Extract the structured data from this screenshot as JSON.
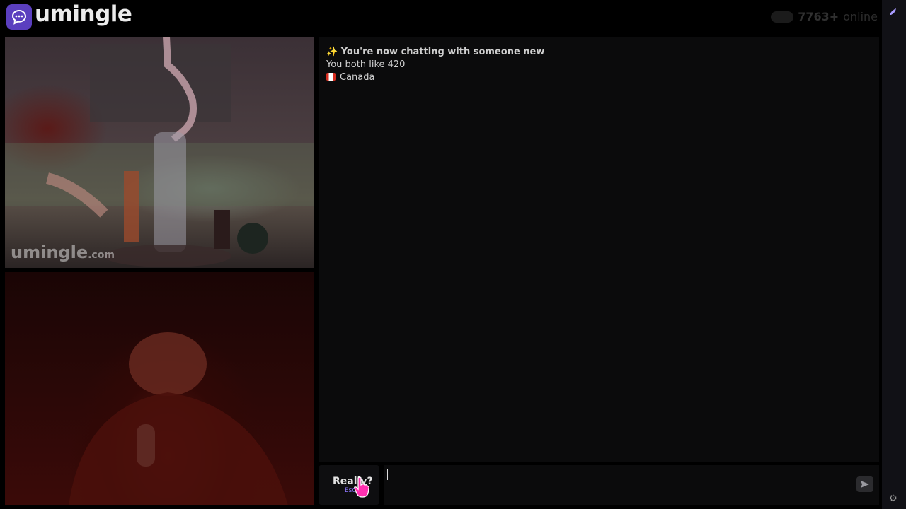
{
  "app": {
    "name": "umingle",
    "online_count": "7763+",
    "online_label": "online"
  },
  "remote_video": {
    "watermark": "umingle",
    "watermark_suffix": ".com"
  },
  "chat": {
    "system_messages": [
      "✨ You're now chatting with someone new",
      "You both like 420",
      "Canada"
    ]
  },
  "controls": {
    "skip_label": "Really?",
    "skip_hint": "Esc",
    "message_value": "",
    "message_placeholder": ""
  },
  "icons": {
    "logo": "chat-bubble-icon",
    "rail_top": "brush-icon",
    "settings": "gear-icon",
    "send": "send-icon",
    "cursor": "hand-pointer-icon"
  },
  "colors": {
    "brand": "#5b3fbf",
    "accent": "#8f77ff",
    "cursor": "#ff2fb0"
  }
}
